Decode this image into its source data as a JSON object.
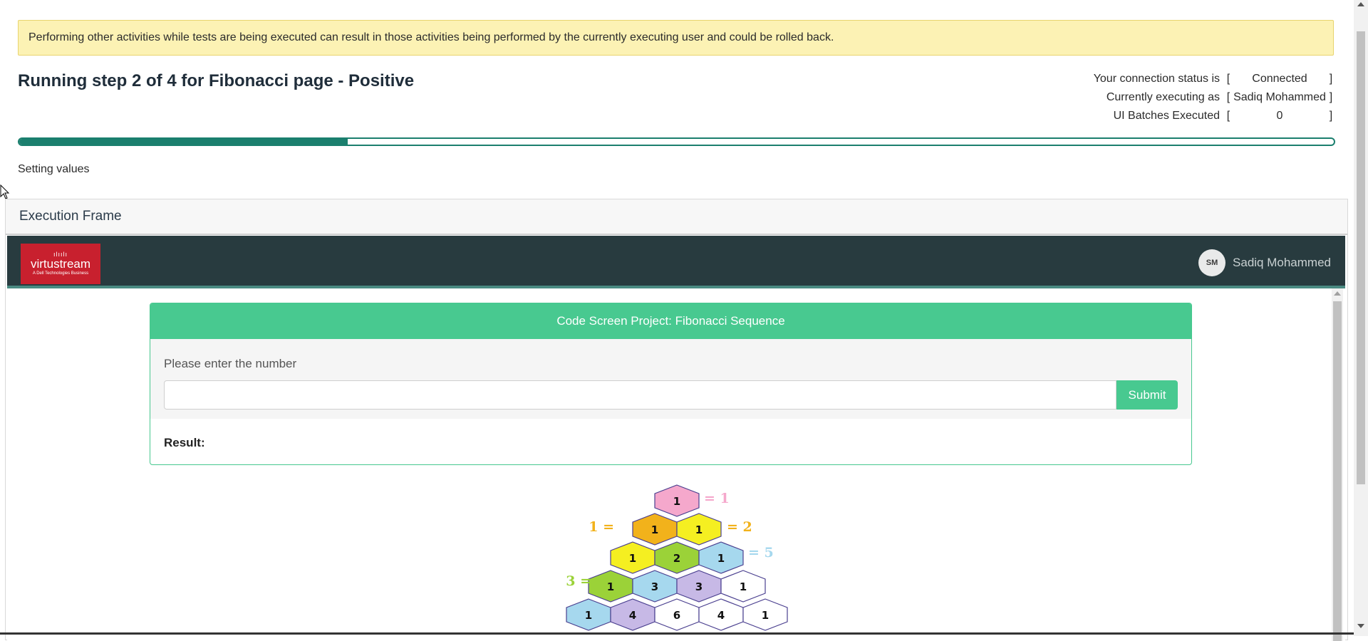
{
  "banner": {
    "text": "Performing other activities while tests are being executed can result in those activities being performed by the currently executing user and could be rolled back."
  },
  "run": {
    "title": "Running step 2 of 4 for Fibonacci page - Positive",
    "progress_fraction": 0.25,
    "message": "Setting values"
  },
  "status": {
    "rows": [
      {
        "label": "Your connection status is",
        "value": "Connected"
      },
      {
        "label": "Currently executing as",
        "value": "Sadiq Mohammed"
      },
      {
        "label": "UI Batches Executed",
        "value": "0"
      }
    ],
    "bracket_open": "[",
    "bracket_close": "]"
  },
  "frame": {
    "title": "Execution Frame"
  },
  "app": {
    "logo": {
      "mark": "ılıılı",
      "name": "virtustream",
      "sub": "A Dell Technologies Business"
    },
    "user": {
      "initials": "SM",
      "name": "Sadiq Mohammed"
    },
    "card": {
      "header": "Code Screen Project: Fibonacci Sequence",
      "label": "Please enter the number",
      "input_value": "",
      "submit": "Submit",
      "result_label": "Result:"
    },
    "pyramid": {
      "rows": [
        [
          "1"
        ],
        [
          "1",
          "1"
        ],
        [
          "1",
          "2",
          "1"
        ],
        [
          "1",
          "3",
          "3",
          "1"
        ],
        [
          "1",
          "4",
          "6",
          "4",
          "1"
        ]
      ],
      "sums": [
        "= 1",
        "1 =",
        "= 2",
        "= 5",
        "3 ="
      ],
      "colors": {
        "pink": "#f5a8cc",
        "orange": "#f2b21b",
        "yellow": "#f5ef21",
        "green": "#9bd238",
        "blue": "#a6d8ee",
        "purple": "#c7b9e6",
        "white": "#ffffff"
      }
    }
  },
  "colors": {
    "accent": "#1b7f6e",
    "brand_green": "#48c990",
    "nav_bg": "#283b3f",
    "logo_red": "#c8202e",
    "banner_bg": "#fcf2b4"
  }
}
